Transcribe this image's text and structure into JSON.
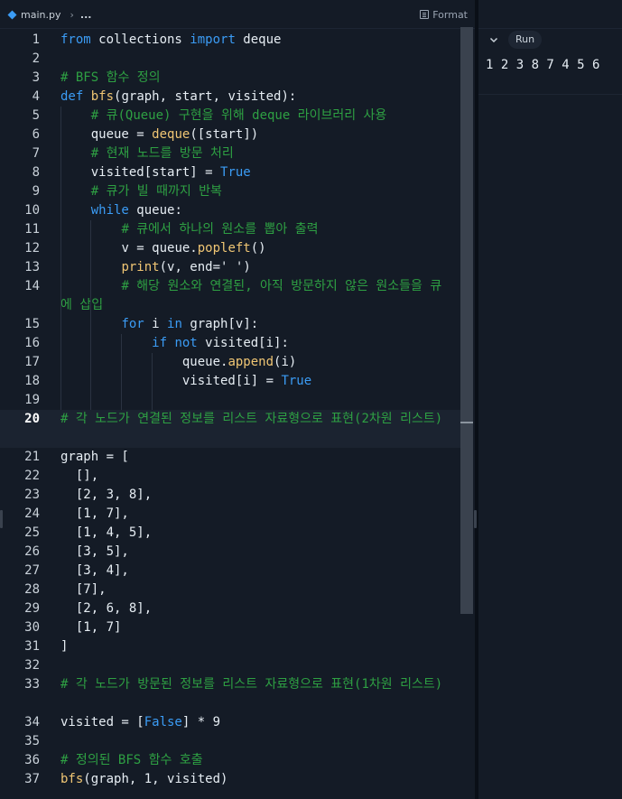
{
  "tab": {
    "filename": "main.py",
    "breadcrumb_more": "...",
    "format_label": "Format"
  },
  "console": {
    "run_label": "Run",
    "output": "1 2 3 8 7 4 5 6"
  },
  "editor": {
    "active_line": 20,
    "lines": [
      {
        "n": "1",
        "tokens": [
          [
            "kw",
            "from"
          ],
          [
            "",
            " collections "
          ],
          [
            "kw",
            "import"
          ],
          [
            "",
            " deque"
          ]
        ]
      },
      {
        "n": "2",
        "tokens": []
      },
      {
        "n": "3",
        "tokens": [
          [
            "cm",
            "# BFS 함수 정의"
          ]
        ]
      },
      {
        "n": "4",
        "tokens": [
          [
            "kw",
            "def"
          ],
          [
            "",
            " "
          ],
          [
            "fn",
            "bfs"
          ],
          [
            "",
            "(graph, start, visited):"
          ]
        ]
      },
      {
        "n": "5",
        "tokens": [
          [
            "",
            "    "
          ],
          [
            "cm",
            "# 큐(Queue) 구현을 위해 deque 라이브러리 사용"
          ]
        ]
      },
      {
        "n": "6",
        "tokens": [
          [
            "",
            "    queue = "
          ],
          [
            "fn",
            "deque"
          ],
          [
            "",
            "([start])"
          ]
        ]
      },
      {
        "n": "7",
        "tokens": [
          [
            "",
            "    "
          ],
          [
            "cm",
            "# 현재 노드를 방문 처리"
          ]
        ]
      },
      {
        "n": "8",
        "tokens": [
          [
            "",
            "    visited[start] = "
          ],
          [
            "kw",
            "True"
          ]
        ]
      },
      {
        "n": "9",
        "tokens": [
          [
            "",
            "    "
          ],
          [
            "cm",
            "# 큐가 빌 때까지 반복"
          ]
        ]
      },
      {
        "n": "10",
        "tokens": [
          [
            "",
            "    "
          ],
          [
            "kw",
            "while"
          ],
          [
            "",
            " queue:"
          ]
        ]
      },
      {
        "n": "11",
        "tokens": [
          [
            "",
            "        "
          ],
          [
            "cm",
            "# 큐에서 하나의 원소를 뽑아 출력"
          ]
        ]
      },
      {
        "n": "12",
        "tokens": [
          [
            "",
            "        v = queue."
          ],
          [
            "meth",
            "popleft"
          ],
          [
            "",
            "()"
          ]
        ]
      },
      {
        "n": "13",
        "tokens": [
          [
            "",
            "        "
          ],
          [
            "fn",
            "print"
          ],
          [
            "",
            "(v, end="
          ],
          [
            "str",
            "' '"
          ],
          [
            "",
            ")"
          ]
        ]
      },
      {
        "n": "14",
        "tall": true,
        "tokens": [
          [
            "",
            "        "
          ],
          [
            "cm",
            "# 해당 원소와 연결된, 아직 방문하지 않은 원소들을 큐에 삽입"
          ]
        ]
      },
      {
        "n": "15",
        "tokens": [
          [
            "",
            "        "
          ],
          [
            "kw",
            "for"
          ],
          [
            "",
            " i "
          ],
          [
            "kw",
            "in"
          ],
          [
            "",
            " graph[v]:"
          ]
        ]
      },
      {
        "n": "16",
        "tokens": [
          [
            "",
            "            "
          ],
          [
            "kw",
            "if"
          ],
          [
            "",
            " "
          ],
          [
            "kw",
            "not"
          ],
          [
            "",
            " visited[i]:"
          ]
        ]
      },
      {
        "n": "17",
        "tokens": [
          [
            "",
            "                queue."
          ],
          [
            "meth",
            "append"
          ],
          [
            "",
            "(i)"
          ]
        ]
      },
      {
        "n": "18",
        "tokens": [
          [
            "",
            "                visited[i] = "
          ],
          [
            "kw",
            "True"
          ]
        ]
      },
      {
        "n": "19",
        "tokens": []
      },
      {
        "n": "20",
        "tall": true,
        "tokens": [
          [
            "cm",
            "# 각 노드가 연결된 정보를 리스트 자료형으로 표현(2차원 리스트)"
          ]
        ]
      },
      {
        "n": "21",
        "tokens": [
          [
            "",
            "graph = ["
          ]
        ]
      },
      {
        "n": "22",
        "tokens": [
          [
            "",
            "  [],"
          ]
        ]
      },
      {
        "n": "23",
        "tokens": [
          [
            "",
            "  [2, 3, 8],"
          ]
        ]
      },
      {
        "n": "24",
        "tokens": [
          [
            "",
            "  [1, 7],"
          ]
        ]
      },
      {
        "n": "25",
        "tokens": [
          [
            "",
            "  [1, 4, 5],"
          ]
        ]
      },
      {
        "n": "26",
        "tokens": [
          [
            "",
            "  [3, 5],"
          ]
        ]
      },
      {
        "n": "27",
        "tokens": [
          [
            "",
            "  [3, 4],"
          ]
        ]
      },
      {
        "n": "28",
        "tokens": [
          [
            "",
            "  [7],"
          ]
        ]
      },
      {
        "n": "29",
        "tokens": [
          [
            "",
            "  [2, 6, 8],"
          ]
        ]
      },
      {
        "n": "30",
        "tokens": [
          [
            "",
            "  [1, 7]"
          ]
        ]
      },
      {
        "n": "31",
        "tokens": [
          [
            "",
            "]"
          ]
        ]
      },
      {
        "n": "32",
        "tokens": []
      },
      {
        "n": "33",
        "tall": true,
        "tokens": [
          [
            "cm",
            "# 각 노드가 방문된 정보를 리스트 자료형으로 표현(1차원 리스트)"
          ]
        ]
      },
      {
        "n": "34",
        "tokens": [
          [
            "",
            "visited = ["
          ],
          [
            "kw",
            "False"
          ],
          [
            "",
            "] * 9"
          ]
        ]
      },
      {
        "n": "35",
        "tokens": []
      },
      {
        "n": "36",
        "tokens": [
          [
            "cm",
            "# 정의된 BFS 함수 호출"
          ]
        ]
      },
      {
        "n": "37",
        "tokens": [
          [
            "fn",
            "bfs"
          ],
          [
            "",
            "(graph, 1, visited)"
          ]
        ]
      }
    ]
  },
  "icons": {
    "file": "python-file-icon",
    "format": "format-icon",
    "chevron": "chevron-down-icon"
  },
  "colors": {
    "keyword": "#3b9cf5",
    "function": "#f0c674",
    "comment": "#2ea043",
    "background": "#141b26"
  }
}
